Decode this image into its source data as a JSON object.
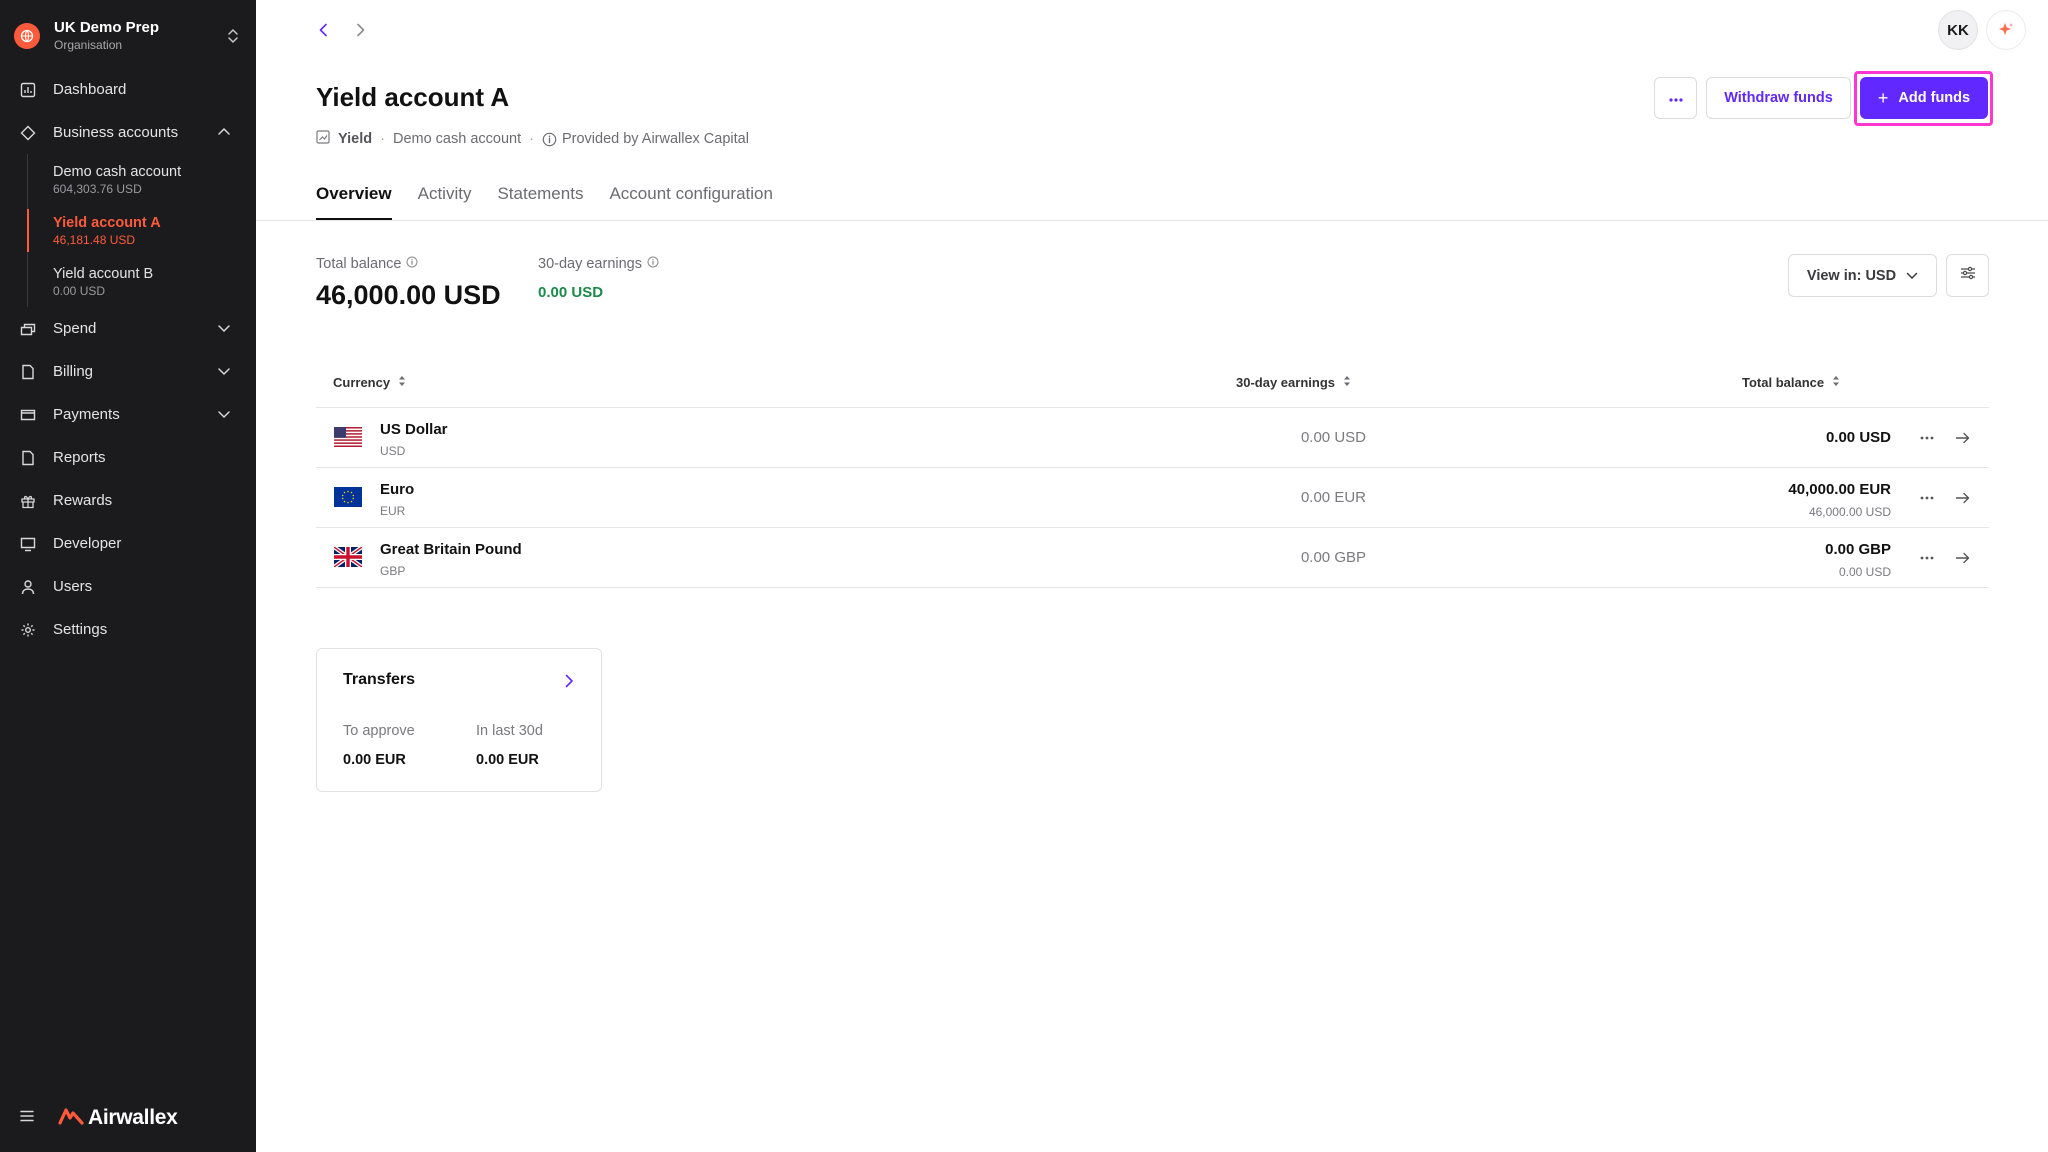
{
  "org": {
    "name": "UK Demo Prep",
    "sub": "Organisation"
  },
  "nav": {
    "dashboard": "Dashboard",
    "business_accounts": "Business accounts",
    "sub_accounts": [
      {
        "name": "Demo cash account",
        "balance": "604,303.76 USD"
      },
      {
        "name": "Yield account A",
        "balance": "46,181.48 USD"
      },
      {
        "name": "Yield account B",
        "balance": "0.00 USD"
      }
    ],
    "spend": "Spend",
    "billing": "Billing",
    "payments": "Payments",
    "reports": "Reports",
    "rewards": "Rewards",
    "developer": "Developer",
    "users": "Users",
    "settings": "Settings"
  },
  "brand": "Airwallex",
  "header": {
    "avatar": "KK",
    "title": "Yield account A",
    "meta_tag": "Yield",
    "meta_account": "Demo cash account",
    "meta_provider": "Provided by Airwallex Capital",
    "more_label": "···",
    "withdraw_label": "Withdraw funds",
    "add_label": "Add funds"
  },
  "tabs": [
    "Overview",
    "Activity",
    "Statements",
    "Account configuration"
  ],
  "summary": {
    "total_label": "Total balance",
    "total_value": "46,000.00 USD",
    "earn_label": "30-day earnings",
    "earn_value": "0.00 USD",
    "view_label": "View in: USD"
  },
  "table": {
    "headers": {
      "currency": "Currency",
      "earnings": "30-day earnings",
      "balance": "Total balance"
    },
    "rows": [
      {
        "name": "US Dollar",
        "code": "USD",
        "earnings": "0.00 USD",
        "balance": "0.00 USD",
        "balance_sub": ""
      },
      {
        "name": "Euro",
        "code": "EUR",
        "earnings": "0.00 EUR",
        "balance": "40,000.00 EUR",
        "balance_sub": "46,000.00 USD"
      },
      {
        "name": "Great Britain Pound",
        "code": "GBP",
        "earnings": "0.00 GBP",
        "balance": "0.00 GBP",
        "balance_sub": "0.00 USD"
      }
    ]
  },
  "transfers": {
    "title": "Transfers",
    "to_approve_label": "To approve",
    "to_approve_value": "0.00 EUR",
    "last30_label": "In last 30d",
    "last30_value": "0.00 EUR"
  },
  "colors": {
    "accent": "#6129ff",
    "brand": "#ff5a3c",
    "sidebar": "#1b1b1d",
    "positive": "#1b8a4a",
    "highlight": "#ff36d2"
  }
}
